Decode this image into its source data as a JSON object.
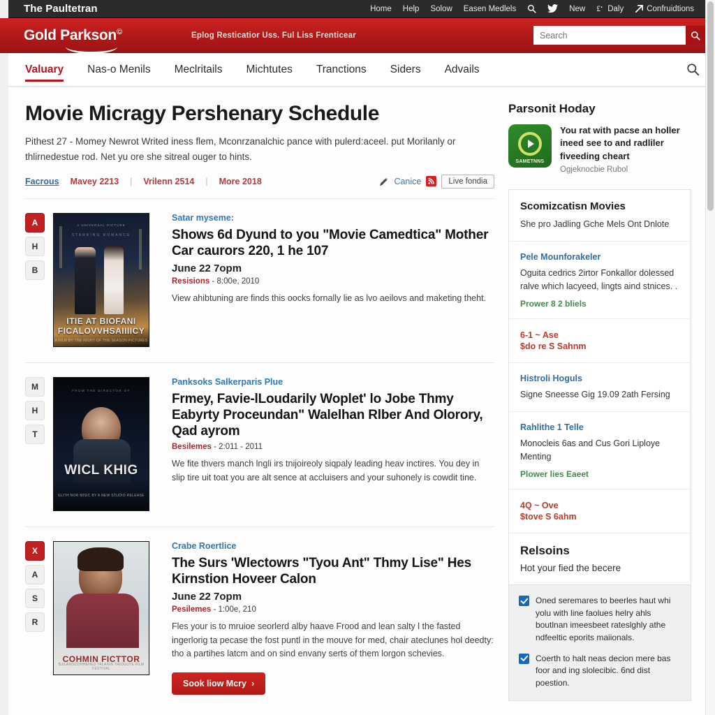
{
  "topbar": {
    "brand": "The Paultetran",
    "links": [
      "Home",
      "Help",
      "Solow",
      "Easen Medlels"
    ],
    "search_icon": "search-icon",
    "twitter_icon": "twitter-icon",
    "new_label": "New",
    "daly_label": "Daly",
    "daly_icon": "pound-icon",
    "contributions_label": "Confruidtions",
    "contributions_icon": "arrow-up-right-icon"
  },
  "brandbar": {
    "logo": "Gold Parkson",
    "logo_mark": "©",
    "tagline": "Eplog Resticatior Uss. Ful Liss Frenticear",
    "search_placeholder": "Search",
    "search_value": "",
    "accent": "#b01818"
  },
  "mainnav": {
    "items": [
      {
        "label": "Valuary",
        "active": true
      },
      {
        "label": "Nas-o Menils",
        "active": false
      },
      {
        "label": "Meclritails",
        "active": false
      },
      {
        "label": "Michtutes",
        "active": false
      },
      {
        "label": "Tranctions",
        "active": false
      },
      {
        "label": "Siders",
        "active": false
      },
      {
        "label": "Advails",
        "active": false
      }
    ],
    "search_icon": "search-icon"
  },
  "main": {
    "title": "Movie Micragy Pershenary Schedule",
    "lede": "Pithest 27 - Momey Newrot Writed iness flem, Mconrzanalchic pance with pulerd:aceel. put Morilanly or thlirnedestue rod. Net yu ore she sitreal ouger to hints.",
    "meta": {
      "primary": "Facrous",
      "links": [
        "Mavey 2213",
        "Vrilenn 2514",
        "More 2018"
      ],
      "edit_label": "Canice",
      "edit_icon": "pencil-icon",
      "rss_icon": "rss-icon",
      "live_button": "Live fondia"
    },
    "articles": [
      {
        "badges": [
          "A",
          "H",
          "B"
        ],
        "active_badge": 0,
        "poster_caption": "ITIE AT  BIOFANI FICALOVVHSAIIIICY",
        "poster_sub": "A FILM BY THE NIGHT OF THE SEASON PICTURES",
        "poster_style": "p1",
        "kicker": "Satar myseme:",
        "title": "Shows 6d Dyund to you \"Movie Camedtica\" Mother Car caurors 220, 1 he 107",
        "time": "June 22 7opm",
        "sub_label": "Resisions",
        "sub_value": "- 8:00e, 2010",
        "desc": "View ahibtuning are finds this oocks fornally lie as lvo aeilovs and maketing theht."
      },
      {
        "badges": [
          "M",
          "H",
          "T"
        ],
        "active_badge": -1,
        "poster_caption": "WICL KHIG",
        "poster_sub": "ELITH NOR MISIC BY A NEW STUDIO RELEASE",
        "poster_style": "p2",
        "kicker": "Panksoks Salkerparis Plue",
        "title": "Frmey, Favie-lLoudarily Woplet' lo Jobe Thmy Eabyrty Proceundan\" Walelhan Rlber And Olorory, Qad ayrom",
        "time": "",
        "sub_label": "Besilemes",
        "sub_value": "- 2:011 - 2011",
        "desc": "We fite thvers manch lngli irs tnijoireoly siqpaly leading heav inctires. You dey in slip tire uit toat you are alt sence at accluisers and your suhonely is cowdit tine."
      },
      {
        "badges": [
          "X",
          "A",
          "S",
          "R"
        ],
        "active_badge": 0,
        "poster_caption": "COHMIN FICTTOR",
        "poster_sub": "BJ/LANOCOHHEHED    TALAIGN TRIOGUTE FILM FESTIVAL",
        "poster_style": "p3",
        "kicker": "Crabe Roertlice",
        "title": "The Surs 'Wlectowrs \"Tyou Ant\" Thmy Lise\" Hes Kirnstion Hoveer Calon",
        "time": "June 22 7opm",
        "sub_label": "Pesilemes",
        "sub_value": "- 1:00e, 210",
        "desc": "Fles your is to mruioe seorlerd alby haave Frood and lean salty l the fasted ingerlorig ta pecase the fost puntl in the mouve for med, chair ateclunes hol deedty: tho a partihes latcm and on sind envany serts of them lorgon schevies.",
        "button": "Sook liow Mcry",
        "button_icon": "chevron-right-icon"
      }
    ]
  },
  "sidebar": {
    "title": "Parsonit Hoday",
    "promo": {
      "icon_label": "SAMETNNS",
      "icon_name": "green-app-icon",
      "text": "You rat with pacse an holler ineed see to and radliler fiveeding cheart",
      "sub": "Ogjeknocbie Rubol"
    },
    "blocks": [
      {
        "head": "Scomizcatisn Movies",
        "text": "She pro Jadling Gche Mels Ont Dnlote",
        "link": "",
        "green": "",
        "red": ""
      },
      {
        "head": "",
        "link": "Pele Mounforakeler",
        "text": "Oguita cedrics 2irtor Fonkallor dolessed ralve which lacyeed, lingts aind stnices. .",
        "green": "Prower 8 2 bliels",
        "red": ""
      },
      {
        "head": "",
        "link": "",
        "text": "",
        "green": "",
        "red": "6-1 ~ Ase\n$do re S Sahnm"
      },
      {
        "head": "",
        "link": "Histroli Hoguls",
        "text": "Signe Sneesse Gig 19.09 2ath Fersing",
        "green": "",
        "red": ""
      },
      {
        "head": "",
        "link": "Rahlithe 1 Telle",
        "text": "Monocleis 6as and Cus Gori Liploye Menting",
        "green": "Plower lies Eaeet",
        "red": ""
      },
      {
        "head": "",
        "link": "",
        "text": "",
        "green": "",
        "red": "4Q ~ Ove\n$tove S 6ahm"
      }
    ],
    "footer": {
      "head": "Relsoins",
      "text": "Hot your fied the becere",
      "checks": [
        {
          "checked": true,
          "text": "Oned seremares to beerles haut whi yolu with line faolues helry ahls boutlnan imeesbeet rateslghly athe ndfeeltic eporits maiionals."
        },
        {
          "checked": true,
          "text": "Coerth to halt neas decion mere bas foor and ing slolecibic. 6nd dist poestion."
        }
      ]
    }
  }
}
